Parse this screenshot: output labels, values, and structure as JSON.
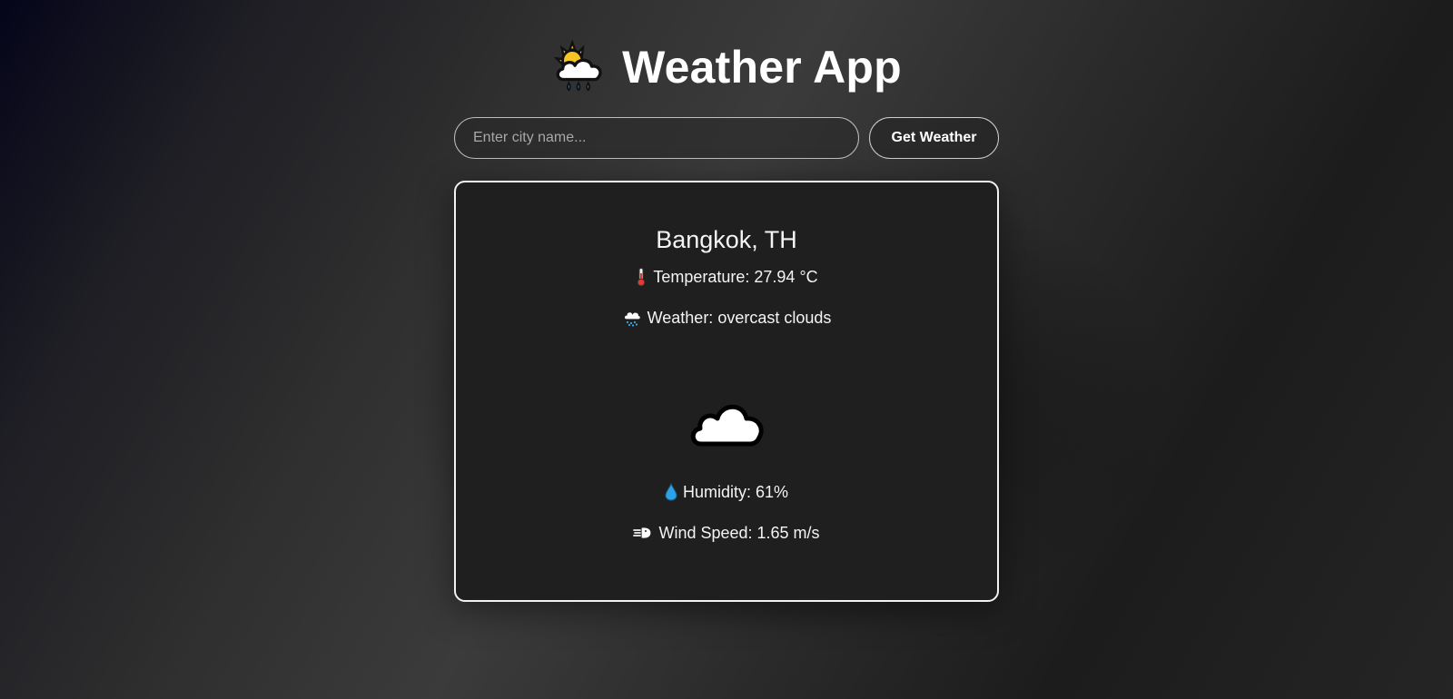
{
  "header": {
    "title": "Weather App",
    "icon": "sun-behind-rain-cloud-icon"
  },
  "search": {
    "placeholder": "Enter city name...",
    "value": "",
    "button_label": "Get Weather"
  },
  "card": {
    "city": "Bangkok, TH",
    "temperature": {
      "icon": "thermometer-icon",
      "text": "Temperature: 27.94 °C"
    },
    "weather": {
      "icon": "cloud-with-rain-icon",
      "text": "Weather: overcast clouds"
    },
    "condition_icon": "cloud-icon",
    "humidity": {
      "icon": "droplet-icon",
      "text": "Humidity: 61%"
    },
    "wind": {
      "icon": "wind-face-icon",
      "text": "Wind Speed: 1.65 m/s"
    }
  },
  "colors": {
    "text": "#ffffff",
    "card_background": "#1f1f1f",
    "card_border": "#f2f2f2",
    "droplet": "#2ba3e6",
    "thermometer": "#e53935"
  }
}
